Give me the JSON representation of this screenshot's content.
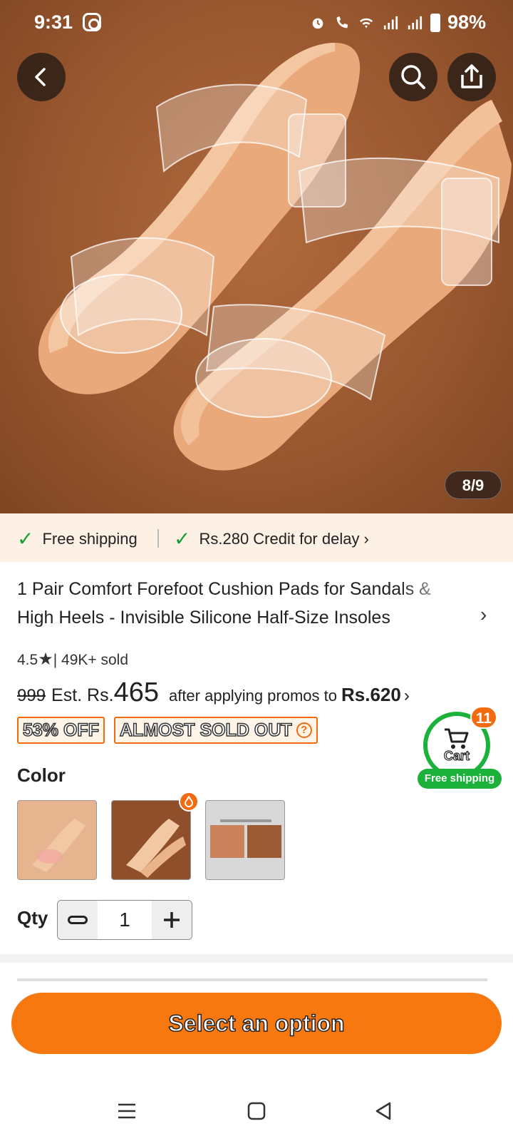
{
  "status_bar": {
    "time": "9:31",
    "battery": "98%",
    "icons": [
      "instagram-icon",
      "alarm-icon",
      "wifi-call-icon",
      "wifi-icon",
      "signal-icon",
      "signal-icon",
      "battery-icon"
    ]
  },
  "gallery": {
    "counter": "8/9",
    "icons": [
      "back-arrow-icon",
      "search-icon",
      "share-icon"
    ]
  },
  "shipping_strip": {
    "free_shipping": "Free shipping",
    "credit": "Rs.280 Credit for delay",
    "chevron": "›"
  },
  "product": {
    "title": "1 Pair Comfort Forefoot Cushion Pads for Sandals & High Heels - Invisible Silicone Half-Size Insoles",
    "rating": "4.5",
    "sold": "| 49K+ sold",
    "original_price": "999",
    "est_label": "Est. Rs.",
    "est_price": "465",
    "promo_text": "after applying promos to",
    "promo_price": "Rs.620",
    "discount_tag": "53% OFF",
    "stock_tag": "ALMOST SOLD OUT",
    "stock_help": "?"
  },
  "cart": {
    "count": "11",
    "label": "Cart",
    "shipping": "Free shipping"
  },
  "options": {
    "color_label": "Color",
    "swatch_count": 3,
    "selected_index": 1,
    "qty_label": "Qty",
    "qty_value": "1"
  },
  "cta": {
    "label": "Select an option"
  },
  "colors": {
    "accent": "#f7780f",
    "success": "#1bb13a",
    "strip_bg": "#fdf0e4"
  }
}
